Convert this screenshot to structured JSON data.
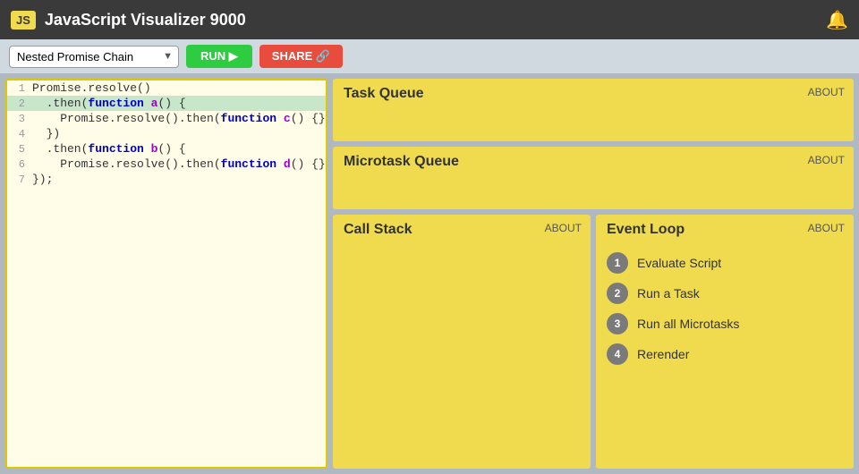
{
  "header": {
    "js_badge": "JS",
    "title": "JavaScript Visualizer 9000",
    "bell_icon": "🔔"
  },
  "toolbar": {
    "scenario": "Nested Promise Chain",
    "run_label": "RUN ▶",
    "share_label": "SHARE 🔗",
    "dropdown_arrow": "▼"
  },
  "code": {
    "lines": [
      {
        "num": "1",
        "content": "Promise.resolve()",
        "highlight": false
      },
      {
        "num": "2",
        "content": "  .then(function a() {",
        "highlight": true
      },
      {
        "num": "3",
        "content": "    Promise.resolve().then(function c() {});",
        "highlight": false
      },
      {
        "num": "4",
        "content": "  })",
        "highlight": false
      },
      {
        "num": "5",
        "content": "  .then(function b() {",
        "highlight": false
      },
      {
        "num": "6",
        "content": "    Promise.resolve().then(function d() {});",
        "highlight": false
      },
      {
        "num": "7",
        "content": "});",
        "highlight": false
      }
    ]
  },
  "task_queue": {
    "title": "Task Queue",
    "about_label": "ABOUT"
  },
  "microtask_queue": {
    "title": "Microtask Queue",
    "about_label": "ABOUT"
  },
  "call_stack": {
    "title": "Call Stack",
    "about_label": "ABOUT"
  },
  "event_loop": {
    "title": "Event Loop",
    "about_label": "ABOUT",
    "steps": [
      {
        "num": "1",
        "label": "Evaluate Script"
      },
      {
        "num": "2",
        "label": "Run a Task"
      },
      {
        "num": "3",
        "label": "Run all Microtasks"
      },
      {
        "num": "4",
        "label": "Rerender"
      }
    ]
  }
}
